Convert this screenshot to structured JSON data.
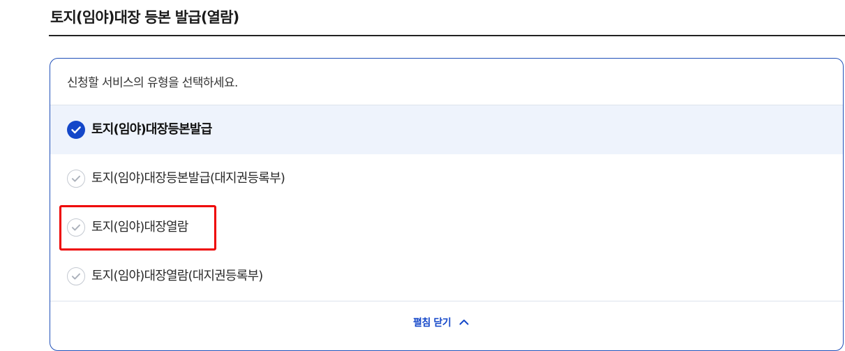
{
  "page": {
    "title": "토지(임야)대장 등본 발급(열람)"
  },
  "panel": {
    "header_text": "신청할 서비스의 유형을 선택하세요.",
    "options": [
      {
        "label": "토지(임야)대장등본발급",
        "selected": true
      },
      {
        "label": "토지(임야)대장등본발급(대지권등록부)",
        "selected": false
      },
      {
        "label": "토지(임야)대장열람",
        "selected": false
      },
      {
        "label": "토지(임야)대장열람(대지권등록부)",
        "selected": false
      }
    ],
    "footer": {
      "collapse_label": "펼침 닫기",
      "icon": "chevron-up-icon"
    }
  },
  "annotation": {
    "highlight_color": "#ee0000",
    "highlighted_option_index": 2
  },
  "colors": {
    "accent": "#1447c9",
    "selected_background": "#eef3fc",
    "panel_border": "#1f4fb8"
  }
}
